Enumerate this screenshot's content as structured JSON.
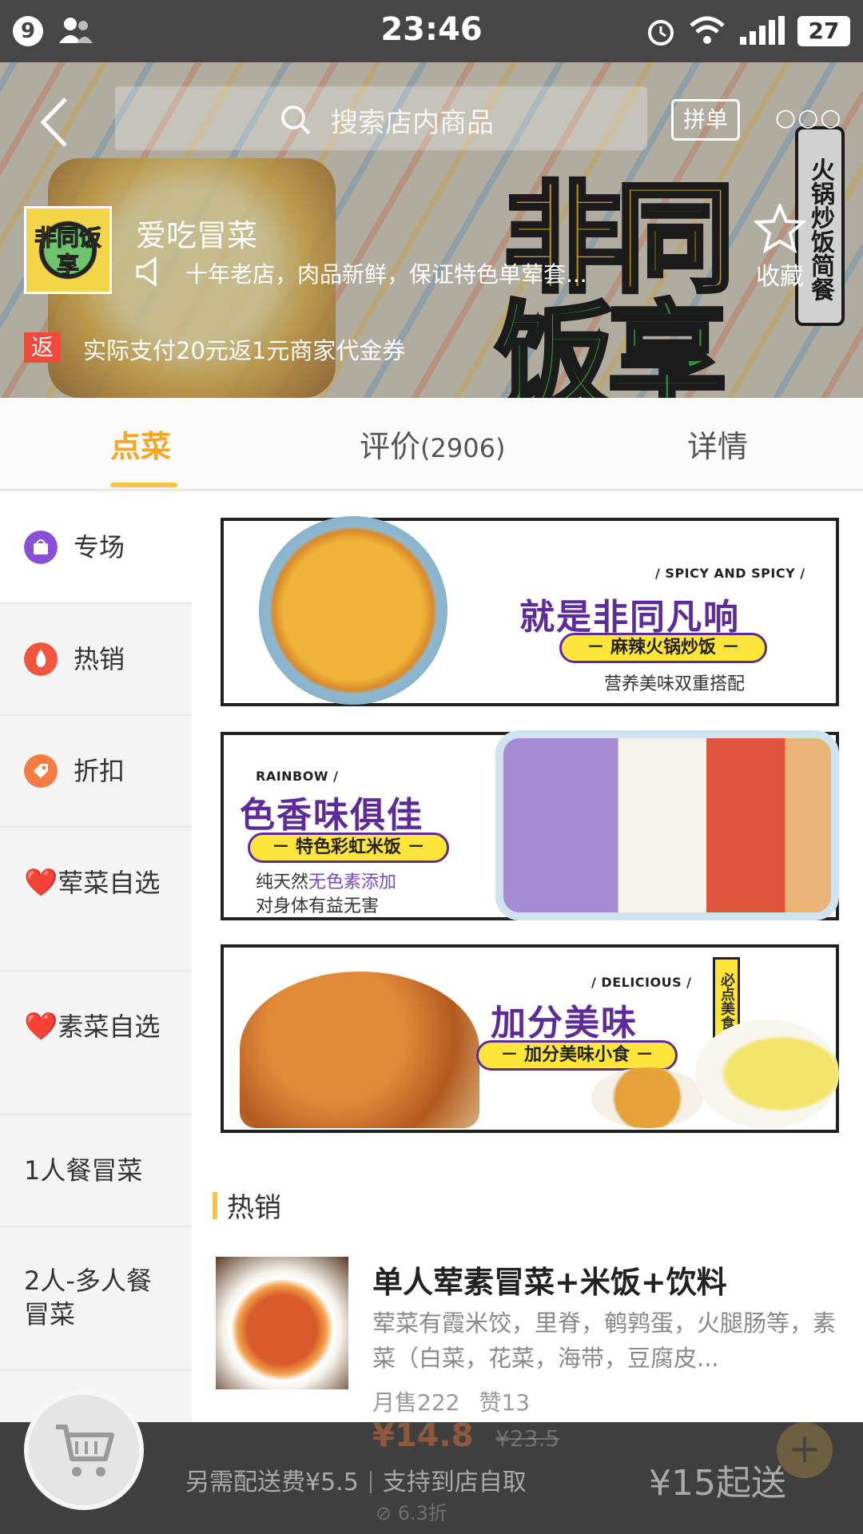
{
  "status_bar": {
    "badge": "9",
    "time": "23:46",
    "battery": "27"
  },
  "header": {
    "search_placeholder": "搜索店内商品",
    "pin_label": "拼单",
    "more_label": "○○○",
    "shop_name": "爱吃冒菜",
    "notice": "十年老店，肉品新鲜，保证特色单荤套...",
    "fav_label": "收藏",
    "rebate_badge": "返",
    "rebate_text": "实际支付20元返1元商家代金券",
    "banner_l1": "非同",
    "banner_l2": "饭享",
    "banner_tag": "火锅炒饭简餐",
    "logo_text": "非同饭享"
  },
  "tabs": [
    {
      "label": "点菜"
    },
    {
      "label": "评价",
      "count": "(2906)"
    },
    {
      "label": "详情"
    }
  ],
  "sidebar": {
    "items": [
      {
        "label": "专场"
      },
      {
        "label": "热销"
      },
      {
        "label": "折扣"
      },
      {
        "label": "荤菜自选"
      },
      {
        "label": "素菜自选"
      },
      {
        "label": "1人餐冒菜"
      },
      {
        "label": "2人-多人餐冒菜"
      }
    ],
    "heart": "❤️"
  },
  "promos": [
    {
      "en": "/  SPICY AND SPICY  /",
      "title": "就是非同凡响",
      "pill": "－  麻辣火锅炒饭  －",
      "sub": "营养美味双重搭配"
    },
    {
      "en": "RAINBOW  /",
      "title": "色香味俱佳",
      "pill": "－  特色彩虹米饭  －",
      "sub1": "纯天然",
      "sub1_hi": "无色素添加",
      "sub2": "对身体有益无害"
    },
    {
      "en": "/  DELICIOUS  /",
      "title": "加分美味",
      "pill": "－  加分美味小食  －",
      "tag": "必点美食"
    }
  ],
  "section": {
    "title": "热销"
  },
  "food": {
    "name": "单人荤素冒菜+米饭+饮料",
    "desc": "荤菜有霞米饺，里脊，鹌鹑蛋，火腿肠等，素菜（白菜，花菜，海带，豆腐皮...",
    "sales": "月售222",
    "likes": "赞13",
    "price": "¥14.8",
    "old_price": "¥23.5",
    "discount": "⊘ 6.3折"
  },
  "bottom_bar": {
    "delivery_fee": "另需配送费¥5.5",
    "pickup": "支持到店自取",
    "min_order": "¥15起送",
    "add_label": "+"
  },
  "colors": {
    "accent": "#f6a623",
    "purple": "#5d2c99",
    "yellow": "#fde53a"
  }
}
